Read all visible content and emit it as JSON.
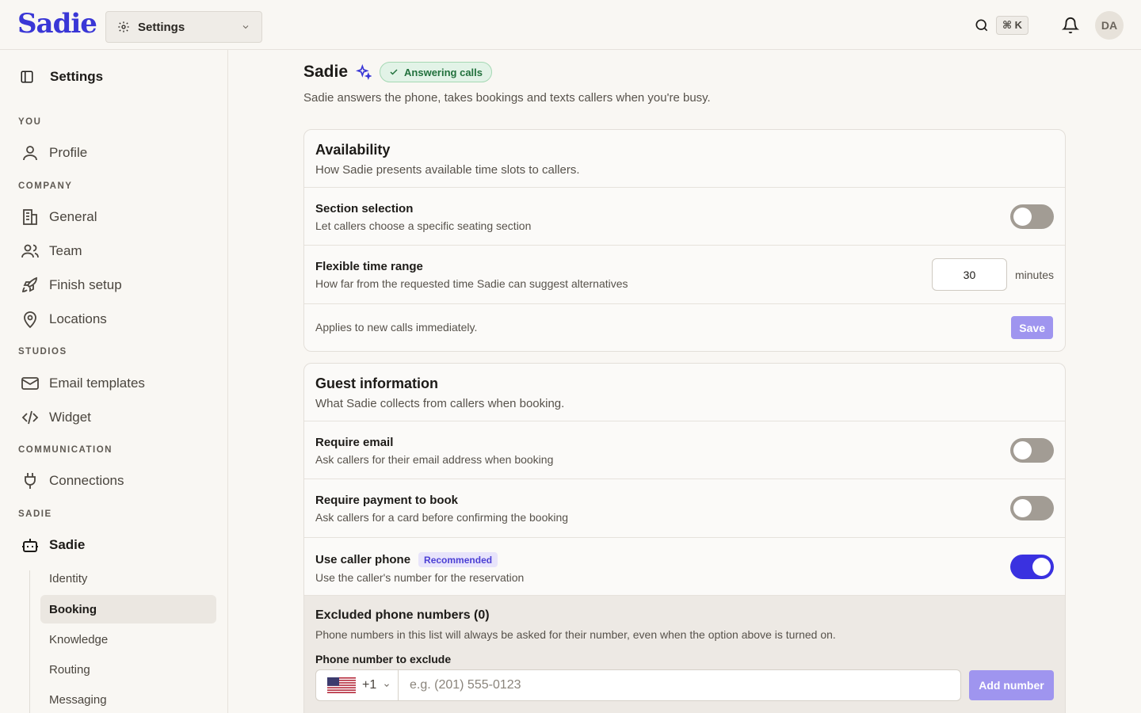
{
  "app": {
    "logo": "Sadie"
  },
  "header": {
    "workspace_select": "Settings",
    "shortcut": "⌘ K",
    "avatar_initials": "DA"
  },
  "sidebar": {
    "title": "Settings",
    "sections": {
      "you": "YOU",
      "company": "COMPANY",
      "studios": "STUDIOS",
      "communication": "COMMUNICATION",
      "sadie": "SADIE"
    },
    "items": {
      "profile": "Profile",
      "general": "General",
      "team": "Team",
      "finish_setup": "Finish setup",
      "locations": "Locations",
      "email_templates": "Email templates",
      "widget": "Widget",
      "connections": "Connections",
      "sadie": "Sadie"
    },
    "sub_items": [
      "Identity",
      "Booking",
      "Knowledge",
      "Routing",
      "Messaging"
    ],
    "active_sub_item": "Booking"
  },
  "main": {
    "title": "Sadie",
    "status_badge": "Answering calls",
    "description": "Sadie answers the phone, takes bookings and texts callers when you're busy.",
    "availability": {
      "title": "Availability",
      "description": "How Sadie presents available time slots to callers.",
      "section_selection": {
        "title": "Section selection",
        "description": "Let callers choose a specific seating section",
        "enabled": false
      },
      "flexible_time": {
        "title": "Flexible time range",
        "description": "How far from the requested time Sadie can suggest alternatives",
        "value": "30",
        "unit": "minutes"
      },
      "footer_note": "Applies to new calls immediately.",
      "save_label": "Save"
    },
    "guest_info": {
      "title": "Guest information",
      "description": "What Sadie collects from callers when booking.",
      "require_email": {
        "title": "Require email",
        "description": "Ask callers for their email address when booking",
        "enabled": false
      },
      "require_payment": {
        "title": "Require payment to book",
        "description": "Ask callers for a card before confirming the booking",
        "enabled": false
      },
      "use_caller_phone": {
        "title": "Use caller phone",
        "badge": "Recommended",
        "description": "Use the caller's number for the reservation",
        "enabled": true
      }
    },
    "excluded": {
      "title": "Excluded phone numbers (0)",
      "description": "Phone numbers in this list will always be asked for their number, even when the option above is turned on.",
      "field_label": "Phone number to exclude",
      "country_code": "+1",
      "phone_placeholder": "e.g. (201) 555-0123",
      "add_label": "Add number"
    }
  },
  "colors": {
    "brand": "#3a37d6",
    "toggle_on": "#3a31e0",
    "toggle_off": "#a29c94",
    "button_disabled": "#9f95ef"
  }
}
